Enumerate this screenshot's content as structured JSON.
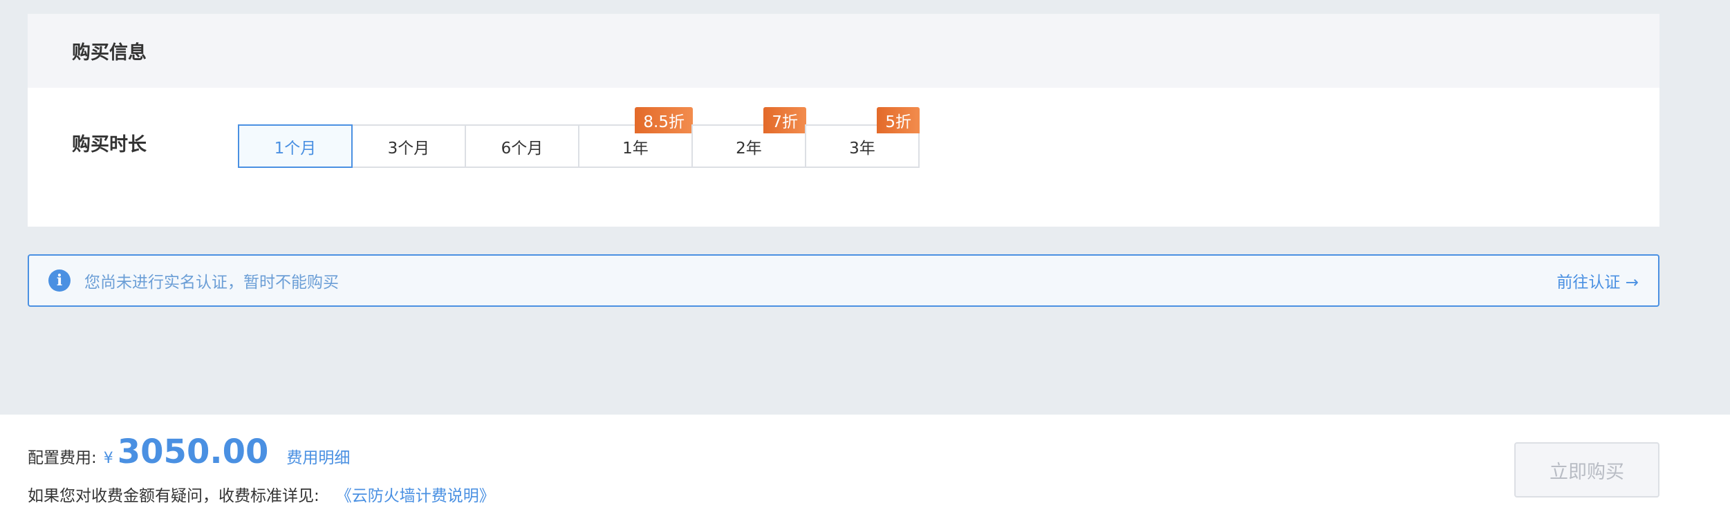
{
  "card": {
    "title": "购买信息",
    "duration_label": "购买时长",
    "options": [
      {
        "label": "1个月",
        "selected": true,
        "badge": null
      },
      {
        "label": "3个月",
        "selected": false,
        "badge": null
      },
      {
        "label": "6个月",
        "selected": false,
        "badge": null
      },
      {
        "label": "1年",
        "selected": false,
        "badge": "8.5折"
      },
      {
        "label": "2年",
        "selected": false,
        "badge": "7折"
      },
      {
        "label": "3年",
        "selected": false,
        "badge": "5折"
      }
    ]
  },
  "alert": {
    "icon": "info-icon",
    "icon_glyph": "i",
    "text": "您尚未进行实名认证，暂时不能购买",
    "link": "前往认证 →"
  },
  "footer": {
    "fee_label": "配置费用:",
    "currency": "¥",
    "price": "3050.00",
    "fee_detail": "费用明细",
    "note": "如果您对收费金额有疑问，收费标准详见:",
    "note_link": "《云防火墙计费说明》",
    "buy_button": "立即购买"
  },
  "colors": {
    "accent": "#4a90e2",
    "badge": "#e36a2a",
    "background": "#e8ecf0"
  }
}
